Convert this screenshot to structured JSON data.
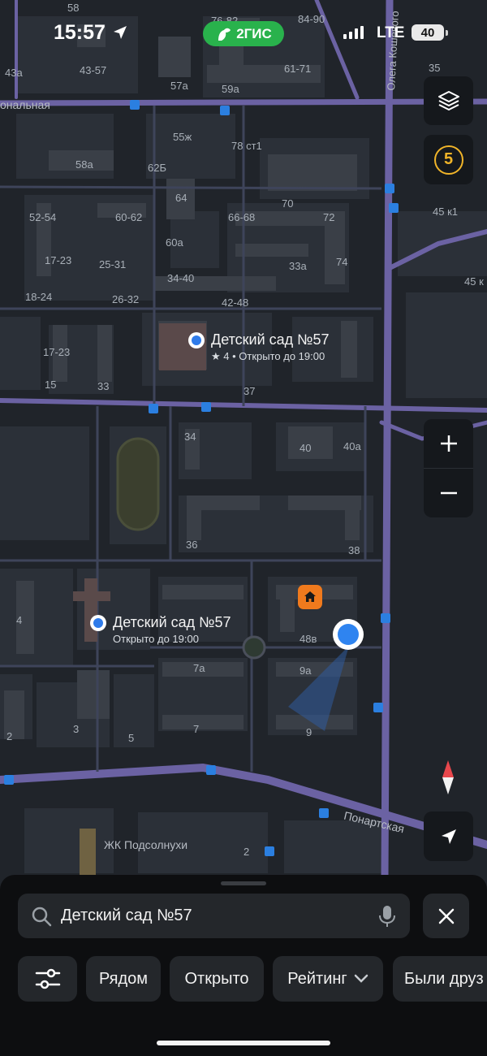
{
  "status_bar": {
    "time": "15:57",
    "brand": "2ГИС",
    "network": "LTE",
    "battery": "40"
  },
  "map": {
    "buildings": [
      "58",
      "76-82",
      "84-90",
      "43а",
      "43-57",
      "61-71",
      "57а",
      "59а",
      "35",
      "55ж",
      "78 ст1",
      "58а",
      "62Б",
      "64",
      "70",
      "72",
      "45 к1",
      "52-54",
      "60-62",
      "66-68",
      "60а",
      "17-23",
      "25-31",
      "33а",
      "74",
      "45 к",
      "34-40",
      "18-24",
      "26-32",
      "42-48",
      "17-23",
      "15",
      "33",
      "37",
      "34",
      "40",
      "40а",
      "36",
      "38",
      "48в",
      "4",
      "7а",
      "9а",
      "2",
      "3",
      "5",
      "7",
      "9",
      "2"
    ],
    "streets": [
      "ональная",
      "Олега Кошевого",
      "Понартская",
      "ЖК Подсолнухи"
    ]
  },
  "pois": [
    {
      "name": "Детский сад №57",
      "rating": "★ 4",
      "hours": "Открыто до 19:00"
    },
    {
      "name": "Детский сад №57",
      "hours": "Открыто до 19:00"
    }
  ],
  "controls": {
    "traffic_level": "5",
    "zoom_in": "+",
    "zoom_out": "−"
  },
  "search": {
    "query": "Детский сад №57"
  },
  "chips": [
    "Рядом",
    "Открыто",
    "Рейтинг",
    "Были друз"
  ],
  "colors": {
    "accent": "#2f7bea",
    "brand": "#29b24c",
    "traffic": "#f0b429",
    "road": "#6b62a3",
    "poi_home": "#f07a1d"
  }
}
